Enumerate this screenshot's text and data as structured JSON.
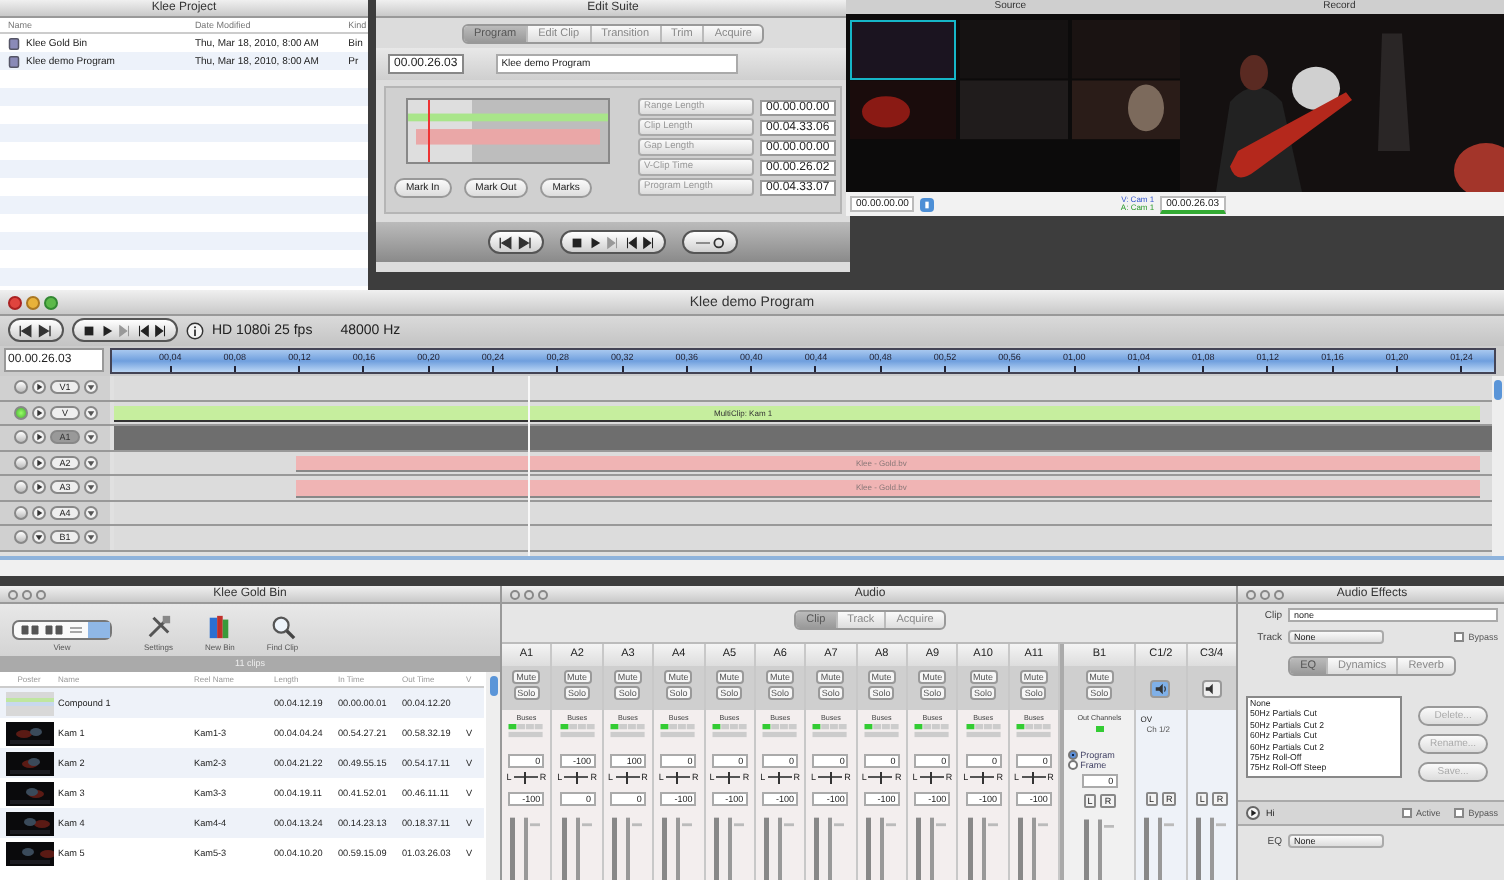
{
  "project_window": {
    "title": "Klee Project",
    "columns": [
      "Name",
      "Date Modified",
      "Kind"
    ],
    "rows": [
      {
        "name": "Klee Gold Bin",
        "date": "Thu, Mar 18, 2010, 8:00 AM",
        "kind": "Bin"
      },
      {
        "name": "Klee demo Program",
        "date": "Thu, Mar 18, 2010, 8:00 AM",
        "kind": "Pr"
      }
    ]
  },
  "edit_suite": {
    "title": "Edit Suite",
    "tabs": [
      {
        "label": "Program",
        "selected": true
      },
      {
        "label": "Edit Clip",
        "selected": false
      },
      {
        "label": "Transition",
        "selected": false
      },
      {
        "label": "Trim",
        "selected": false
      },
      {
        "label": "Acquire",
        "selected": false
      }
    ],
    "timecode": "00.00.26.03",
    "name": "Klee demo Program",
    "mark_buttons": [
      "Mark In",
      "Mark Out",
      "Marks"
    ],
    "fields": [
      {
        "label": "Range Length",
        "value": "00.00.00.00"
      },
      {
        "label": "Clip Length",
        "value": "00.04.33.06"
      },
      {
        "label": "Gap Length",
        "value": "00.00.00.00"
      },
      {
        "label": "V-Clip Time",
        "value": "00.00.26.02"
      },
      {
        "label": "Program Length",
        "value": "00.04.33.07"
      }
    ]
  },
  "viewer": {
    "source_title": "Source",
    "record_title": "Record",
    "source_timecode": "00.00.00.00",
    "video_label": "V: Cam 1",
    "audio_label": "A: Cam 1",
    "record_timecode": "00.00.26.03"
  },
  "timeline": {
    "title": "Klee demo Program",
    "format": "HD 1080i 25 fps",
    "sample_rate": "48000 Hz",
    "timecode": "00.00.26.03",
    "ruler": [
      "00,04",
      "00,08",
      "00,12",
      "00,16",
      "00,20",
      "00,24",
      "00,28",
      "00,32",
      "00,36",
      "00,40",
      "00,44",
      "00,48",
      "00,52",
      "00,56",
      "01,00",
      "01,04",
      "01,08",
      "01,12",
      "01,16",
      "01,20",
      "01,24"
    ],
    "tracks": [
      {
        "label": "V1",
        "kind": "video",
        "selected": false,
        "enabled": true
      },
      {
        "label": "V",
        "kind": "video",
        "selected": true,
        "enabled": true,
        "clip": {
          "kind": "multiclip",
          "label": "MultiClip: Kam 1"
        }
      },
      {
        "label": "A1",
        "kind": "audio",
        "selected": false,
        "enabled": false
      },
      {
        "label": "A2",
        "kind": "audio",
        "selected": false,
        "enabled": true,
        "clip": {
          "kind": "audio",
          "label": "Klee - Gold.bv"
        }
      },
      {
        "label": "A3",
        "kind": "audio",
        "selected": false,
        "enabled": true,
        "clip": {
          "kind": "audio",
          "label": "Klee - Gold.bv"
        }
      },
      {
        "label": "A4",
        "kind": "audio",
        "selected": false,
        "enabled": true
      },
      {
        "label": "B1",
        "kind": "bus",
        "selected": false,
        "enabled": true
      }
    ]
  },
  "bin": {
    "title": "Klee Gold Bin",
    "tools": [
      {
        "label": "View",
        "kind": "view"
      },
      {
        "label": "Settings",
        "kind": "settings"
      },
      {
        "label": "New Bin",
        "kind": "newbin"
      },
      {
        "label": "Find Clip",
        "kind": "find"
      }
    ],
    "count": "11 clips",
    "columns": [
      "Poster",
      "Name",
      "Reel Name",
      "Length",
      "In Time",
      "Out Time",
      "V"
    ],
    "rows": [
      {
        "kind": "compound",
        "name": "Compound 1",
        "length": "00.04.12.19",
        "in": "00.00.00.01",
        "out": "00.04.12.20"
      },
      {
        "kind": "picture",
        "name": "Kam 1",
        "reel": "Kam1-3",
        "length": "00.04.04.24",
        "in": "00.54.27.21",
        "out": "00.58.32.19",
        "col7": "V"
      },
      {
        "kind": "picture",
        "name": "Kam 2",
        "reel": "Kam2-3",
        "length": "00.04.21.22",
        "in": "00.49.55.15",
        "out": "00.54.17.11",
        "col7": "V"
      },
      {
        "kind": "picture",
        "name": "Kam 3",
        "reel": "Kam3-3",
        "length": "00.04.19.11",
        "in": "00.41.52.01",
        "out": "00.46.11.11",
        "col7": "V"
      },
      {
        "kind": "picture",
        "name": "Kam 4",
        "reel": "Kam4-4",
        "length": "00.04.13.24",
        "in": "00.14.23.13",
        "out": "00.18.37.11",
        "col7": "V"
      },
      {
        "kind": "picture",
        "name": "Kam 5",
        "reel": "Kam5-3",
        "length": "00.04.10.20",
        "in": "00.59.15.09",
        "out": "01.03.26.03",
        "col7": "V"
      }
    ]
  },
  "audio": {
    "title": "Audio",
    "tabs": [
      {
        "label": "Clip",
        "selected": true
      },
      {
        "label": "Track",
        "selected": false
      },
      {
        "label": "Acquire",
        "selected": false
      }
    ],
    "channels": [
      {
        "kind": "track",
        "name": "A1",
        "mute": "Mute",
        "solo": "Solo",
        "buses": "Buses",
        "pan": "0",
        "level": 0.5,
        "left": "L",
        "right": "R",
        "gain": "-100"
      },
      {
        "kind": "track",
        "name": "A2",
        "mute": "Mute",
        "solo": "Solo",
        "buses": "Buses",
        "pan": "-100",
        "level": 0.5,
        "left": "L",
        "right": "R",
        "gain": "0"
      },
      {
        "kind": "track",
        "name": "A3",
        "mute": "Mute",
        "solo": "Solo",
        "buses": "Buses",
        "pan": "100",
        "level": 0.5,
        "left": "L",
        "right": "R",
        "gain": "0"
      },
      {
        "kind": "track",
        "name": "A4",
        "mute": "Mute",
        "solo": "Solo",
        "buses": "Buses",
        "pan": "0",
        "level": 0.5,
        "left": "L",
        "right": "R",
        "gain": "-100"
      },
      {
        "kind": "track",
        "name": "A5",
        "mute": "Mute",
        "solo": "Solo",
        "buses": "Buses",
        "pan": "0",
        "level": 0.5,
        "left": "L",
        "right": "R",
        "gain": "-100"
      },
      {
        "kind": "track",
        "name": "A6",
        "mute": "Mute",
        "solo": "Solo",
        "buses": "Buses",
        "pan": "0",
        "level": 0.5,
        "left": "L",
        "right": "R",
        "gain": "-100"
      },
      {
        "kind": "track",
        "name": "A7",
        "mute": "Mute",
        "solo": "Solo",
        "buses": "Buses",
        "pan": "0",
        "level": 0.5,
        "left": "L",
        "right": "R",
        "gain": "-100"
      },
      {
        "kind": "track",
        "name": "A8",
        "mute": "Mute",
        "solo": "Solo",
        "buses": "Buses",
        "pan": "0",
        "level": 0.5,
        "left": "L",
        "right": "R",
        "gain": "-100"
      },
      {
        "kind": "track",
        "name": "A9",
        "mute": "Mute",
        "solo": "Solo",
        "buses": "Buses",
        "pan": "0",
        "level": 0.5,
        "left": "L",
        "right": "R",
        "gain": "-100"
      },
      {
        "kind": "track",
        "name": "A10",
        "mute": "Mute",
        "solo": "Solo",
        "buses": "Buses",
        "pan": "0",
        "level": 0.5,
        "left": "L",
        "right": "R",
        "gain": "-100"
      },
      {
        "kind": "track",
        "name": "A11",
        "mute": "Mute",
        "solo": "Solo",
        "buses": "Buses",
        "pan": "0",
        "level": 0.5,
        "left": "L",
        "right": "R",
        "gain": "-100"
      },
      {
        "kind": "bus",
        "name": "B1",
        "mute": "Mute",
        "solo": "Solo",
        "out": "Out Channels",
        "options": [
          {
            "label": "Program",
            "selected": true
          },
          {
            "label": "Frame",
            "selected": false
          }
        ],
        "value": "0",
        "left": "L",
        "right": "R"
      },
      {
        "kind": "output",
        "name": "C1/2",
        "active": true,
        "source": "OV",
        "channel": "Ch 1/2",
        "left": "L",
        "right": "R"
      },
      {
        "kind": "output",
        "name": "C3/4",
        "active": false,
        "left": "L",
        "right": "R"
      }
    ]
  },
  "effects": {
    "title": "Audio Effects",
    "clip_label": "Clip",
    "clip_value": "none",
    "track_label": "Track",
    "track_value": "None",
    "bypass": {
      "label": "Bypass",
      "checked": false
    },
    "tabs": [
      {
        "label": "EQ",
        "selected": true
      },
      {
        "label": "Dynamics",
        "selected": false
      },
      {
        "label": "Reverb",
        "selected": false
      }
    ],
    "presets": [
      {
        "label": "None",
        "selected": false
      },
      {
        "label": "50Hz Partials Cut",
        "selected": false
      },
      {
        "label": "50Hz Partials Cut 2",
        "selected": false
      },
      {
        "label": "60Hz Partials Cut",
        "selected": false
      },
      {
        "label": "60Hz Partials Cut 2",
        "selected": false
      },
      {
        "label": "75Hz Roll-Off",
        "selected": false
      },
      {
        "label": "75Hz Roll-Off Steep",
        "selected": false
      }
    ],
    "buttons": [
      {
        "label": "Delete...",
        "disabled": true
      },
      {
        "label": "Rename...",
        "disabled": true
      },
      {
        "label": "Save...",
        "disabled": true
      }
    ],
    "band": {
      "label": "Hi",
      "expanded": false,
      "active": {
        "label": "Active",
        "checked": false
      },
      "bypass": {
        "label": "Bypass",
        "checked": false
      }
    },
    "eq_label": "EQ",
    "eq_value": "None"
  }
}
